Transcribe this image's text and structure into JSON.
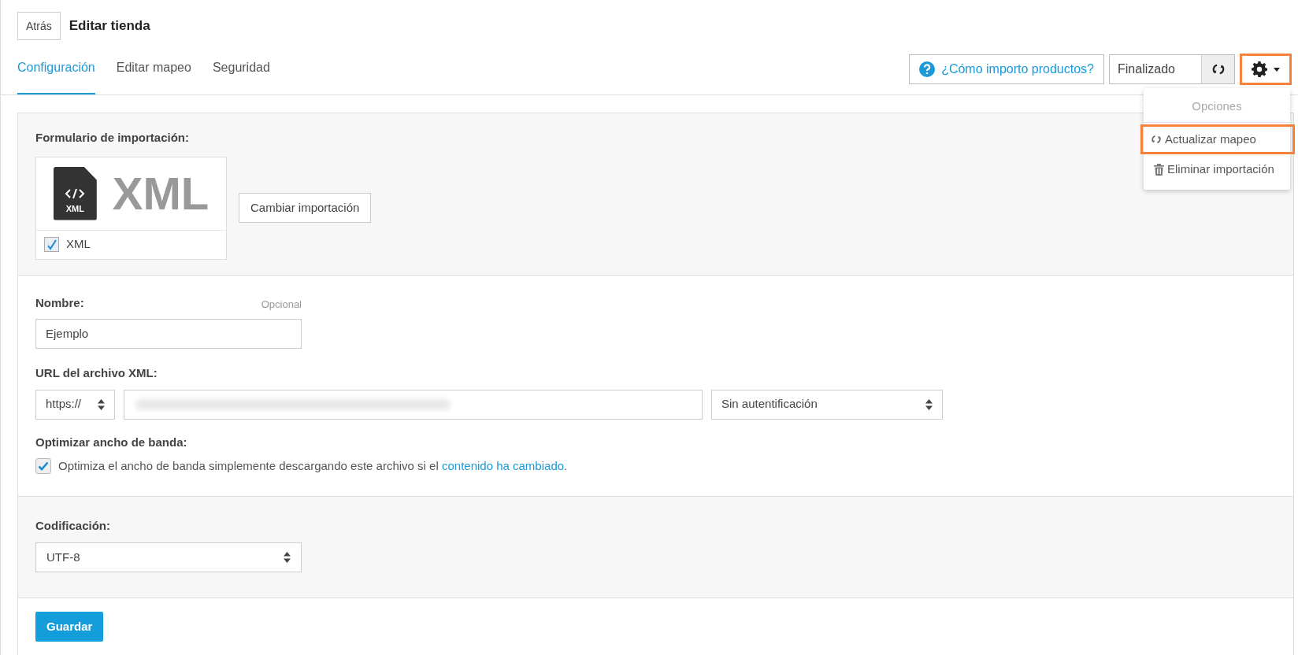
{
  "header": {
    "back_button": "Atrás",
    "title": "Editar tienda"
  },
  "tabs": [
    {
      "label": "Configuración",
      "selected": true
    },
    {
      "label": "Editar mapeo",
      "selected": false
    },
    {
      "label": "Seguridad",
      "selected": false
    }
  ],
  "toolbar": {
    "help_button": "¿Cómo importo productos?",
    "status": "Finalizado",
    "settings_button": {
      "highlighted": true,
      "expanded": true
    }
  },
  "options_menu": {
    "heading": "Opciones",
    "items": [
      {
        "kind": "refresh",
        "label": "Actualizar mapeo",
        "highlighted": true
      },
      {
        "kind": "delete",
        "label": "Eliminar importación",
        "highlighted": false
      }
    ]
  },
  "import_form": {
    "label": "Formulario de importación:",
    "format": {
      "icon_text": "XML",
      "logo_text": "XML",
      "label": "XML",
      "checked": true
    },
    "change_button": "Cambiar importación"
  },
  "name": {
    "label": "Nombre:",
    "hint": "Opcional",
    "value": "Ejemplo"
  },
  "url": {
    "label": "URL del archivo XML:",
    "protocol": "https://",
    "auth": "Sin autentificación"
  },
  "bandwidth": {
    "label": "Optimizar ancho de banda:",
    "checked": true,
    "text": "Optimiza el ancho de banda simplemente descargando este archivo si el ",
    "link": "contenido ha cambiado",
    "text_end": "."
  },
  "encoding": {
    "label": "Codificación:",
    "value": "UTF-8"
  },
  "save_button": "Guardar"
}
